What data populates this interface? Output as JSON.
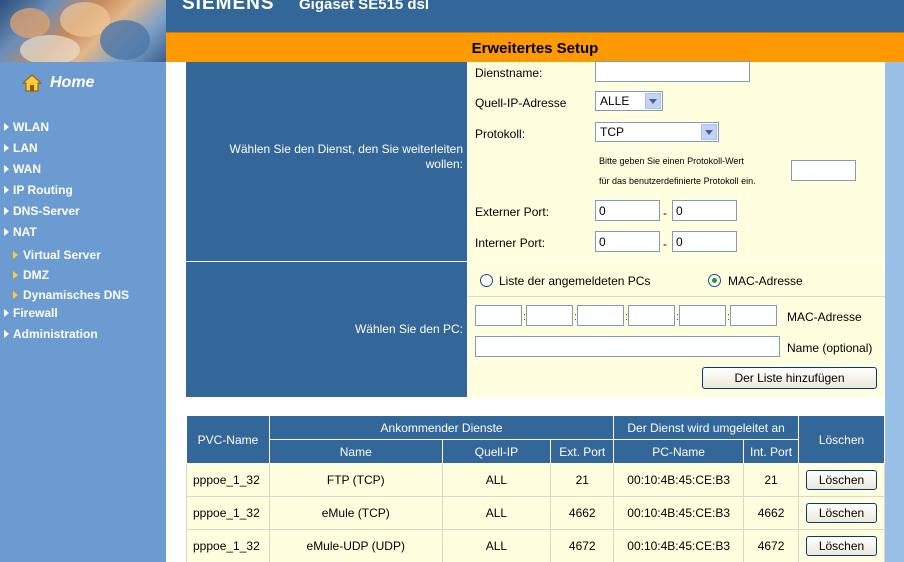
{
  "header": {
    "brand": "SIEMENS",
    "product": "Gigaset SE515 dsl",
    "page_title": "Erweitertes Setup"
  },
  "sidebar": {
    "home": "Home",
    "items": [
      "WLAN",
      "LAN",
      "WAN",
      "IP Routing",
      "DNS-Server",
      "NAT"
    ],
    "nat_sub": [
      "Virtual Server",
      "DMZ",
      "Dynamisches DNS"
    ],
    "items_after": [
      "Firewall",
      "Administration"
    ]
  },
  "service_section": {
    "row_label": "Wählen Sie den Dienst, den Sie weiterleiten wollen:",
    "service_name_label": "Dienstname:",
    "service_name_value": "",
    "source_ip_label": "Quell-IP-Adresse",
    "source_ip_value": "ALLE",
    "protocol_label": "Protokoll:",
    "protocol_value": "TCP",
    "protocol_hint_1": "Bitte geben Sie einen Protokoll-Wert",
    "protocol_hint_2": "für das benutzerdefinierte Protokoll ein.",
    "protocol_custom_value": "",
    "external_port_label": "Externer Port:",
    "external_port_from": "0",
    "external_port_to": "0",
    "internal_port_label": "Interner Port:",
    "internal_port_from": "0",
    "internal_port_to": "0",
    "dash": "-"
  },
  "pc_section": {
    "row_label": "Wählen Sie den PC:",
    "radio_list_label": "Liste der angemeldeten PCs",
    "radio_mac_label": "MAC-Adresse",
    "mac_label": "MAC-Adresse",
    "name_label": "Name (optional)",
    "colon": ":",
    "add_button": "Der Liste hinzufügen"
  },
  "table": {
    "headers": {
      "pvc": "PVC-Name",
      "incoming": "Ankommender Dienste",
      "redirect": "Der Dienst wird umgeleitet an",
      "delete": "Löschen",
      "name": "Name",
      "source_ip": "Quell-IP",
      "ext_port": "Ext. Port",
      "pc_name": "PC-Name",
      "int_port": "Int. Port"
    },
    "rows": [
      {
        "pvc": "pppoe_1_32",
        "name": "FTP (TCP)",
        "source_ip": "ALL",
        "ext_port": "21",
        "pc_name": "00:10:4B:45:CE:B3",
        "int_port": "21",
        "delete": "Löschen"
      },
      {
        "pvc": "pppoe_1_32",
        "name": "eMule (TCP)",
        "source_ip": "ALL",
        "ext_port": "4662",
        "pc_name": "00:10:4B:45:CE:B3",
        "int_port": "4662",
        "delete": "Löschen"
      },
      {
        "pvc": "pppoe_1_32",
        "name": "eMule-UDP (UDP)",
        "source_ip": "ALL",
        "ext_port": "4672",
        "pc_name": "00:10:4B:45:CE:B3",
        "int_port": "4672",
        "delete": "Löschen"
      }
    ]
  },
  "colors": {
    "header_blue": "#336699",
    "orange_bar": "#ff9900",
    "sidebar_blue": "#6c9bd2",
    "form_bg": "#ffffe0"
  }
}
